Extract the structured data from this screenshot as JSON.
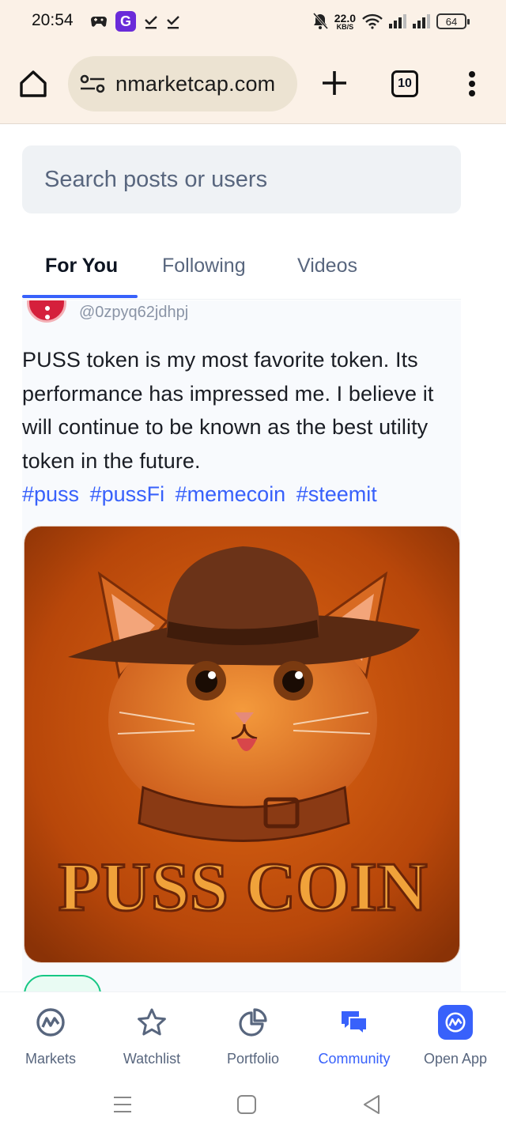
{
  "status_bar": {
    "time": "20:54",
    "net_speed_value": "22.0",
    "net_speed_unit": "KB/S",
    "battery": "64"
  },
  "browser": {
    "url": "nmarketcap.com",
    "tab_count": "10"
  },
  "search": {
    "placeholder": "Search posts or users"
  },
  "feed_tabs": [
    {
      "label": "For You",
      "active": true
    },
    {
      "label": "Following",
      "active": false
    },
    {
      "label": "Videos",
      "active": false
    }
  ],
  "post": {
    "handle": "@0zpyq62jdhpj",
    "text": "PUSS token is my most favorite token. Its performance has impressed me. I believe it will continue to be known as the best utility token in the future.",
    "hashtags": [
      "#puss",
      "#pussFi",
      "#memecoin",
      "#steemit"
    ],
    "image": {
      "caption_text": "PUSS COIN"
    }
  },
  "bottom_nav": [
    {
      "label": "Markets",
      "icon": "cmc-logo-icon",
      "active": false
    },
    {
      "label": "Watchlist",
      "icon": "star-icon",
      "active": false
    },
    {
      "label": "Portfolio",
      "icon": "pie-chart-icon",
      "active": false
    },
    {
      "label": "Community",
      "icon": "chat-bubbles-icon",
      "active": true
    },
    {
      "label": "Open App",
      "icon": "app-logo-icon",
      "active": false
    }
  ],
  "colors": {
    "accent": "#3861fb",
    "browser_chrome": "#fbf1e7",
    "text_secondary": "#58667e"
  }
}
